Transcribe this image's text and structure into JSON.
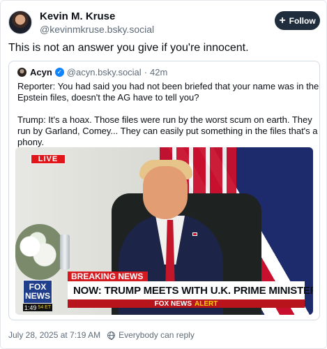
{
  "author": {
    "name": "Kevin M. Kruse",
    "handle": "@kevinmkruse.bsky.social"
  },
  "follow_button": {
    "label": "Follow",
    "icon": "plus-icon"
  },
  "post": {
    "text": "This is not an answer you give if you're innocent.",
    "timestamp": "July 28, 2025 at 7:19 AM",
    "reply_setting": "Everybody can reply"
  },
  "quote": {
    "name": "Acyn",
    "handle": "@acyn.bsky.social",
    "separator": "·",
    "time": "42m",
    "verified_icon": "check-badge-icon",
    "lines": [
      "Reporter: You had said you had not been briefed that your name was in the",
      "Epstein files, doesn't the AG have to tell you?",
      "",
      "Trump: It's a hoax. Those files were run by the worst scum on earth. They",
      "run by Garland, Comey... They can easily put something in the files that's a",
      "phony."
    ]
  },
  "video": {
    "live_label": "LIVE",
    "breaking_label": "BREAKING NEWS",
    "headline": "NOW: TRUMP MEETS WITH U.K. PRIME MINISTER STARMER",
    "alert_brand": "FOX NEWS",
    "alert_word": "ALERT",
    "logo_line1": "FOX",
    "logo_line2": "NEWS",
    "clock": "1:49",
    "clock_zone": "54 ET"
  },
  "colors": {
    "follow_bg": "#1f2d3d",
    "verified": "#1083fe",
    "breaking_red": "#d71920",
    "fox_blue": "#1f3e8c"
  }
}
